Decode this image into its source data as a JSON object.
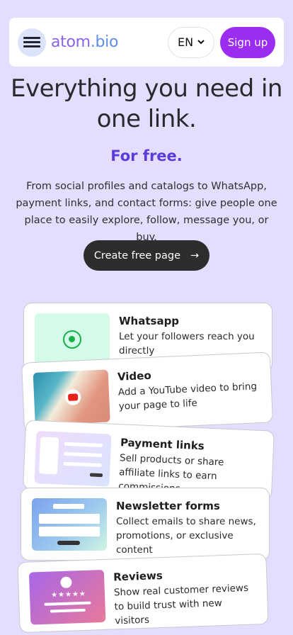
{
  "header": {
    "logo_name": "atom",
    "logo_domain": ".bio",
    "lang_label": "EN",
    "signup_label": "Sign up"
  },
  "hero": {
    "title_line1": "Everything you need in",
    "title_line2": "one link.",
    "subtitle": "For free.",
    "description": "From social profiles and catalogs to WhatsApp, payment links, and contact forms: give people one place to easily explore, follow, message you, or buy.",
    "cta_label": "Create free page",
    "cta_arrow": "→"
  },
  "features": [
    {
      "title": "Whatsapp",
      "desc": "Let your followers reach you directly",
      "icon": "whatsapp-icon"
    },
    {
      "title": "Video",
      "desc": "Add a YouTube video to bring your page to life",
      "icon": "youtube-icon"
    },
    {
      "title": "Payment links",
      "desc": "Sell products or share affiliate links to earn commissions",
      "icon": "payment-form-icon"
    },
    {
      "title": "Newsletter forms",
      "desc": "Collect emails to share news, promotions, or exclusive content",
      "icon": "newsletter-form-icon"
    },
    {
      "title": "Reviews",
      "desc": "Show real customer reviews to build trust with new visitors",
      "icon": "review-card-icon"
    }
  ],
  "review_stars": "★★★★★",
  "colors": {
    "background": "#e4ddfd",
    "accent": "#9a2df0",
    "subtitle": "#5a3dd8"
  }
}
